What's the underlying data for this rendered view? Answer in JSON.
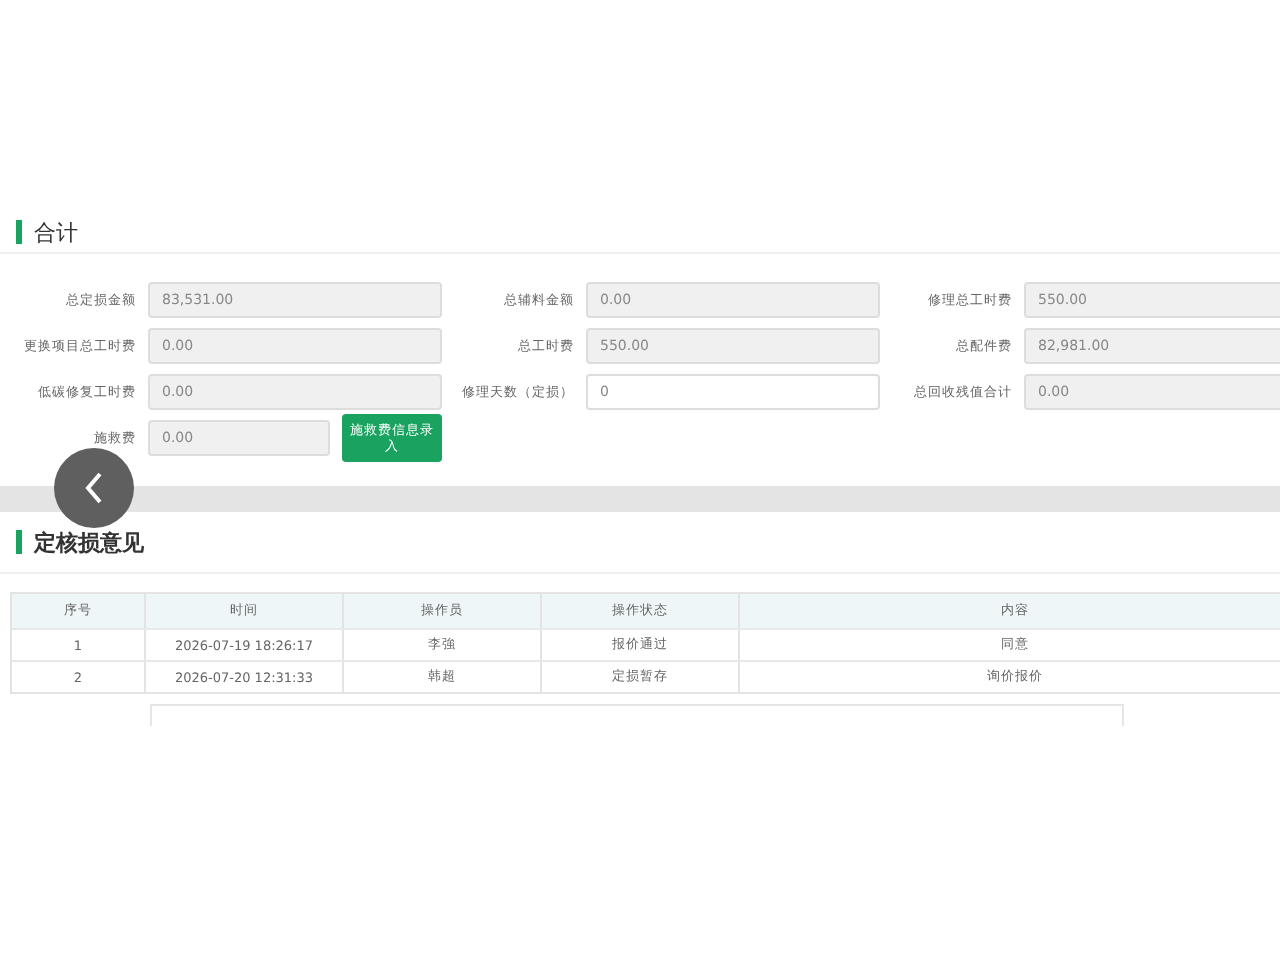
{
  "summary": {
    "title": "合计",
    "fields": [
      {
        "label": "总定损金额",
        "value": "83,531.00",
        "disabled": true
      },
      {
        "label": "总辅料金额",
        "value": "0.00",
        "disabled": true
      },
      {
        "label": "修理总工时费",
        "value": "550.00",
        "disabled": true
      },
      {
        "label": "更换项目总工时费",
        "value": "0.00",
        "disabled": true
      },
      {
        "label": "总工时费",
        "value": "550.00",
        "disabled": true
      },
      {
        "label": "总配件费",
        "value": "82,981.00",
        "disabled": true
      },
      {
        "label": "低碳修复工时费",
        "value": "0.00",
        "disabled": true
      },
      {
        "label": "修理天数（定损）",
        "value": "0",
        "disabled": false
      },
      {
        "label": "总回收残值合计",
        "value": "0.00",
        "disabled": true
      },
      {
        "label": "施救费",
        "value": "0.00",
        "disabled": true
      }
    ],
    "button": "施救费信息录入"
  },
  "opinions": {
    "title": "定核损意见",
    "columns": [
      "序号",
      "时间",
      "操作员",
      "操作状态",
      "内容"
    ],
    "rows": [
      [
        "1",
        "2026-07-19 18:26:17",
        "李強",
        "报价通过",
        "同意"
      ],
      [
        "2",
        "2026-07-20 12:31:33",
        "韩超",
        "定损暂存",
        "询价报价"
      ]
    ]
  }
}
